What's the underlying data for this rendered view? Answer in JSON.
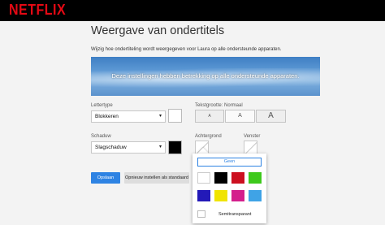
{
  "header": {
    "logo": "NETFLIX"
  },
  "page": {
    "title": "Weergave van ondertitels",
    "subtitle": "Wijzig hoe ondertiteling wordt weergegeven voor Laura op alle ondersteunde apparaten.",
    "banner_text": "Deze instellingen hebben betrekking op alle ondersteunde apparaten."
  },
  "font": {
    "label": "Lettertype",
    "value": "Blokkeren",
    "swatch_color": "#ffffff"
  },
  "text_size": {
    "label": "Tekstgrootte: Normaal",
    "options": [
      "A",
      "A",
      "A"
    ]
  },
  "shadow": {
    "label": "Schaduw",
    "value": "Slagschaduw",
    "swatch_color": "#000000"
  },
  "background": {
    "label": "Achtergrond"
  },
  "window": {
    "label": "Venster"
  },
  "buttons": {
    "save": "Opslaan",
    "reset": "Opnieuw instellen als standaard"
  },
  "color_popup": {
    "none_label": "Geen",
    "colors": [
      "#ffffff",
      "#000000",
      "#cc1020",
      "#3ec91c",
      "#2319b8",
      "#f0e400",
      "#d41e8c",
      "#3fa3e6"
    ],
    "semi_label": "Semitransparant"
  },
  "icons": {
    "dropdown": "chevron-down-icon"
  }
}
